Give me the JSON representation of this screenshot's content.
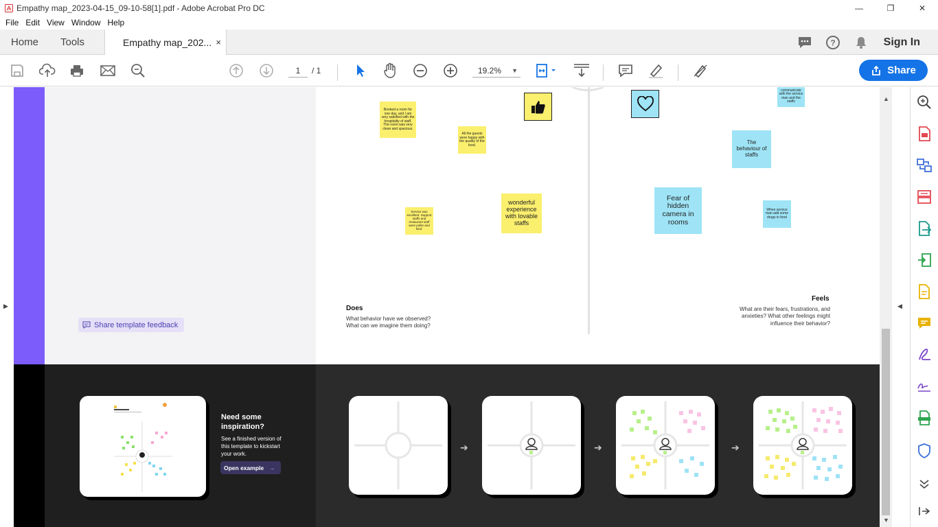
{
  "window": {
    "title": "Empathy map_2023-04-15_09-10-58[1].pdf - Adobe Acrobat Pro DC",
    "minimize": "—",
    "restore": "❐",
    "close": "✕"
  },
  "menu": [
    "File",
    "Edit",
    "View",
    "Window",
    "Help"
  ],
  "tabs": {
    "home": "Home",
    "tools": "Tools",
    "doc": "Empathy map_202...",
    "doc_close": "×",
    "sign_in": "Sign In"
  },
  "toolbar": {
    "page_current": "1",
    "page_total": "/ 1",
    "zoom": "19.2%",
    "zoom_caret": "▼",
    "share": "Share"
  },
  "canvas": {
    "notes_yellow": [
      "Booked a room for one day, and I am very satisfied with the hospitality of staff. The room was very clean and spacious.",
      "All the guests were happy with the quality of the food.",
      "Service was excellent. Support staffs and restaurant staff were polite and kind.",
      "wonderful experience with lovable staffs"
    ],
    "notes_blue": [
      "communicate with the service man and the staffs",
      "The behaviour of staffs",
      "Fear of hidden camera in rooms",
      "When service man add some drugs in food"
    ],
    "does_title": "Does",
    "does_text": "What behavior have we observed?\nWhat can we imagine them doing?",
    "feels_title": "Feels",
    "feels_text": "What are their fears, frustrations, and\nanxieties? What other feelings might\ninfluence their behavior?"
  },
  "feedback_label": "Share template feedback",
  "inspiration": {
    "title": "Need some inspiration?",
    "text": "See a finished version of this template to kickstart your work.",
    "button": "Open example"
  },
  "colors": {
    "accent": "#1473e6",
    "purple": "#7c5cfa",
    "sticky_yellow": "#fbef6e",
    "sticky_blue": "#9ee4f6"
  }
}
